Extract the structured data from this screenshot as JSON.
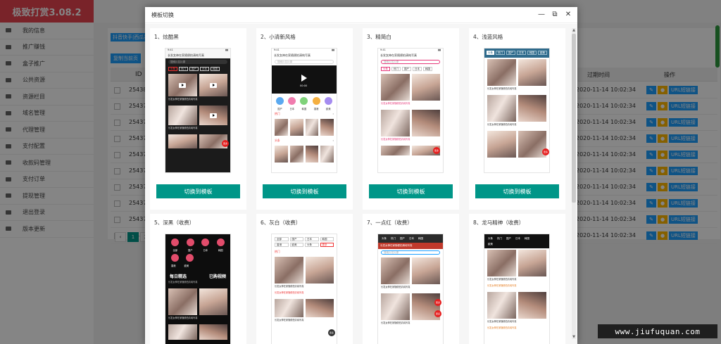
{
  "app": {
    "brand": "极致打赏3.08.2",
    "sidebar": [
      "我的信息",
      "推广赚钱",
      "盒子推广",
      "公共资源",
      "资源栏目",
      "域名管理",
      "代理管理",
      "支付配置",
      "收款码管理",
      "支付订单",
      "提现管理",
      "退出登录",
      "版本更新"
    ],
    "tag_button": "抖音快手|西瓜视",
    "copy_button": "复制当前页",
    "table": {
      "col_id": "ID",
      "col_expire": "过期时间",
      "col_ops": "操作",
      "rows": [
        {
          "id": "25438",
          "expire": "2020-11-14 10:02:34"
        },
        {
          "id": "25437",
          "expire": "2020-11-14 10:02:34"
        },
        {
          "id": "25437",
          "expire": "2020-11-14 10:02:34"
        },
        {
          "id": "25437",
          "expire": "2020-11-14 10:02:34"
        },
        {
          "id": "25437",
          "expire": "2020-11-14 10:02:34"
        },
        {
          "id": "25437",
          "expire": "2020-11-14 10:02:34"
        },
        {
          "id": "25437",
          "expire": "2020-11-14 10:02:34"
        },
        {
          "id": "25437",
          "expire": "2020-11-14 10:02:34"
        },
        {
          "id": "25437",
          "expire": "2020-11-14 10:02:34"
        },
        {
          "id": "25437",
          "expire": "2020-11-14 10:02:34"
        }
      ],
      "op_url_label": "URL短链接"
    },
    "pager": [
      "1",
      "2"
    ]
  },
  "modal": {
    "title": "模板切换",
    "ctrl_min": "—",
    "ctrl_max": "⧉",
    "ctrl_close": "✕",
    "switch_label": "切换到模板",
    "templates": [
      {
        "title": "1、炫酷黑"
      },
      {
        "title": "2、小清新风格"
      },
      {
        "title": "3、精简白"
      },
      {
        "title": "4、浅蓝风格"
      },
      {
        "title": "5、深黑（收费）"
      },
      {
        "title": "6、灰白（收费）"
      },
      {
        "title": "7、一点红（收费）"
      },
      {
        "title": "8、龙马精神（收费）"
      }
    ],
    "mock": {
      "search_placeholder": "搜索片名片源",
      "tags": [
        "头条",
        "热门",
        "国产",
        "日本",
        "韩国",
        "欧美"
      ],
      "caption": "长发女神在家随便拍清纯写真",
      "time": "00:00",
      "cats": [
        "全部",
        "国产",
        "日本",
        "韩国",
        "香港",
        "欧美"
      ],
      "daily": "每日精选",
      "bought": "已购视频",
      "redbtn": "更多"
    }
  },
  "watermark": "www.jiufuquan.com"
}
